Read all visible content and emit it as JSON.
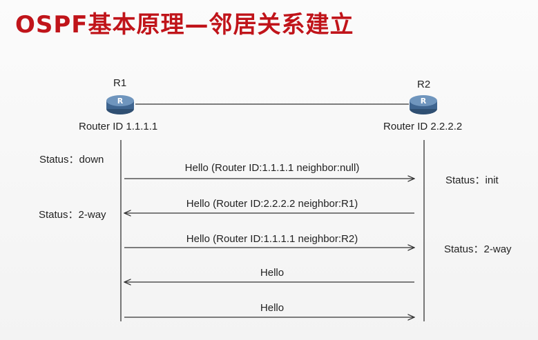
{
  "title": "OSPF基本原理—邻居关系建立",
  "routers": [
    {
      "name": "R1",
      "router_id": "Router ID 1.1.1.1",
      "icon": "router-icon"
    },
    {
      "name": "R2",
      "router_id": "Router ID 2.2.2.2",
      "icon": "router-icon"
    }
  ],
  "r1_status": [
    "Status：down",
    "Status：2-way"
  ],
  "r2_status": [
    "Status：init",
    "Status：2-way"
  ],
  "messages": [
    {
      "label": "Hello (Router ID:1.1.1.1 neighbor:null)",
      "direction": "R1->R2"
    },
    {
      "label": "Hello (Router ID:2.2.2.2 neighbor:R1)",
      "direction": "R2->R1"
    },
    {
      "label": "Hello (Router ID:1.1.1.1 neighbor:R2)",
      "direction": "R1->R2"
    },
    {
      "label": "Hello",
      "direction": "R2->R1"
    },
    {
      "label": "Hello",
      "direction": "R1->R2"
    }
  ],
  "colors": {
    "title": "#c0141a",
    "router_body": "#4a6f96",
    "lines": "#333333"
  }
}
